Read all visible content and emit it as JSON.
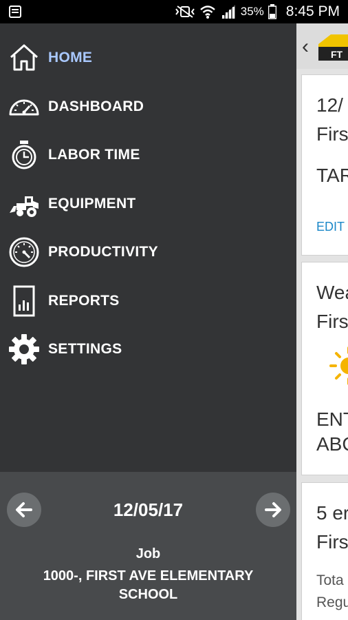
{
  "status_bar": {
    "battery": "35%",
    "time": "8:45 PM"
  },
  "menu": {
    "items": [
      {
        "label": "HOME",
        "icon": "home-icon",
        "active": true
      },
      {
        "label": "DASHBOARD",
        "icon": "dashboard-gauge-icon",
        "active": false
      },
      {
        "label": "LABOR TIME",
        "icon": "stopwatch-icon",
        "active": false
      },
      {
        "label": "EQUIPMENT",
        "icon": "bulldozer-icon",
        "active": false
      },
      {
        "label": "PRODUCTIVITY",
        "icon": "speedometer-icon",
        "active": false
      },
      {
        "label": "REPORTS",
        "icon": "report-chart-icon",
        "active": false
      },
      {
        "label": "SETTINGS",
        "icon": "gear-icon",
        "active": false
      }
    ]
  },
  "footer": {
    "date": "12/05/17",
    "job_label": "Job",
    "job_name": "1000-, FIRST AVE ELEMENTARY SCHOOL"
  },
  "content": {
    "logo_text": "FT",
    "card1": {
      "line1": "12/",
      "line2": "Firs",
      "line3": "TAR",
      "edit": "EDIT"
    },
    "card2": {
      "line1": "Wea",
      "line2": "Firs",
      "line3": "ENT",
      "line4": "ABC"
    },
    "card3": {
      "line1": "5 er",
      "line2": "Firs",
      "line3": "Tota",
      "line4": "Regu"
    }
  },
  "colors": {
    "drawer_bg": "#333436",
    "footer_bg": "#484a4c",
    "active_label": "#a9c8ff",
    "link_blue": "#1a87c8"
  }
}
